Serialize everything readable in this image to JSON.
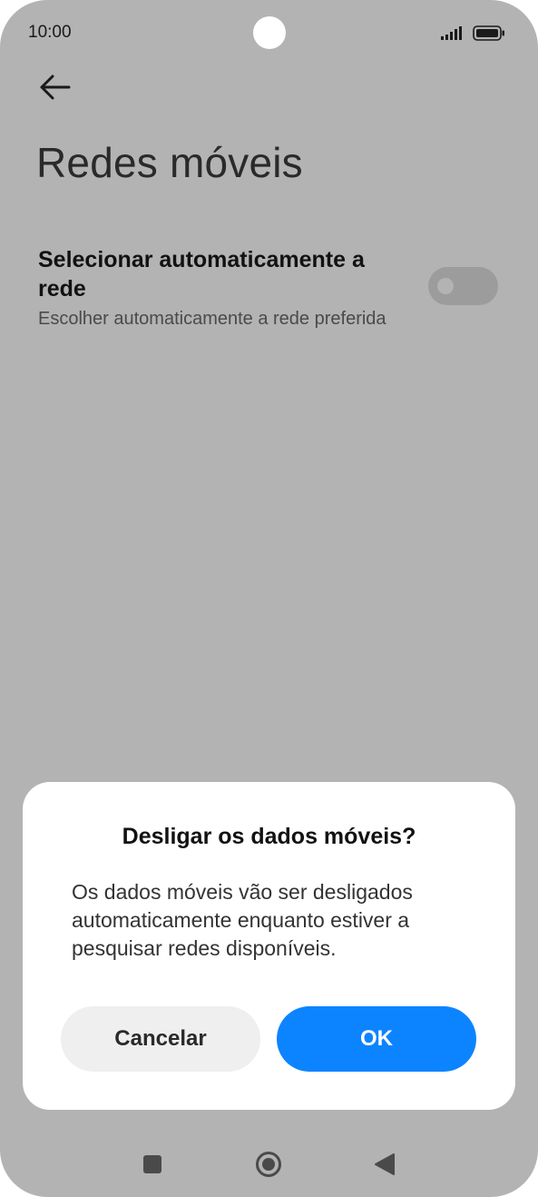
{
  "status_bar": {
    "time": "10:00",
    "icons": [
      "signal-icon",
      "battery-icon"
    ]
  },
  "header": {
    "back_icon": "arrow-left-icon",
    "title": "Redes móveis"
  },
  "setting": {
    "title": "Selecionar automaticamente a rede",
    "subtitle": "Escolher automaticamente a rede preferida",
    "toggle_on": false
  },
  "dialog": {
    "title": "Desligar os dados móveis?",
    "body": "Os dados móveis vão ser desligados automaticamente enquanto estiver a pesquisar redes disponíveis.",
    "cancel_label": "Cancelar",
    "ok_label": "OK"
  },
  "nav_bar": {
    "icons": [
      "recents-square-icon",
      "home-circle-icon",
      "back-triangle-icon"
    ]
  },
  "colors": {
    "overlay_background": "#b3b3b3",
    "dialog_background": "#ffffff",
    "accent": "#0d84ff",
    "cancel_button": "#efefef"
  }
}
